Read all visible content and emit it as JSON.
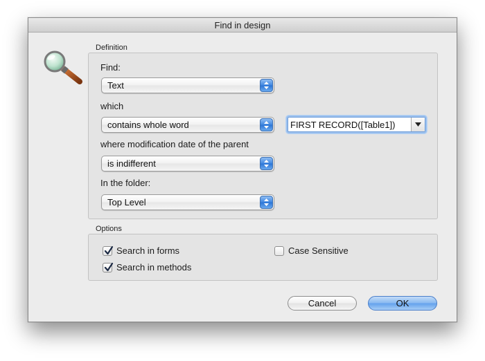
{
  "window": {
    "title": "Find in design"
  },
  "definition": {
    "group_label": "Definition",
    "find": {
      "label": "Find:",
      "value": "Text"
    },
    "which": {
      "label": "which",
      "value": "contains whole word"
    },
    "search_text": {
      "value": "FIRST RECORD([Table1])"
    },
    "modification": {
      "label": "where modification date of the parent",
      "value": "is indifferent"
    },
    "folder": {
      "label": "In the folder:",
      "value": "Top Level"
    }
  },
  "options": {
    "group_label": "Options",
    "search_in_forms": {
      "label": "Search in forms",
      "checked": true
    },
    "search_in_methods": {
      "label": "Search in methods",
      "checked": true
    },
    "case_sensitive": {
      "label": "Case Sensitive",
      "checked": false
    }
  },
  "buttons": {
    "cancel": "Cancel",
    "ok": "OK"
  },
  "icons": {
    "dialog_icon": "magnifying-glass-icon"
  }
}
